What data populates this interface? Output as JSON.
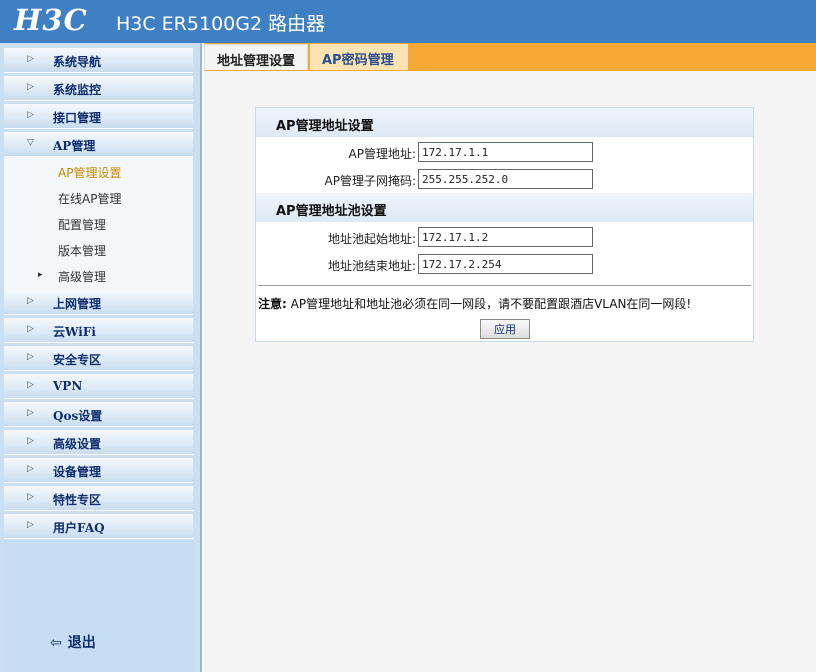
{
  "header": {
    "logo": "H3C",
    "title": "H3C ER5100G2 路由器"
  },
  "sidebar": {
    "items_top": [
      {
        "label": "系统导航"
      },
      {
        "label": "系统监控"
      },
      {
        "label": "接口管理"
      },
      {
        "label": "AP管理"
      }
    ],
    "sub_items": [
      {
        "label": "AP管理设置",
        "active": true
      },
      {
        "label": "在线AP管理"
      },
      {
        "label": "配置管理"
      },
      {
        "label": "版本管理"
      },
      {
        "label": "高级管理"
      }
    ],
    "items_bottom": [
      {
        "label": "上网管理"
      },
      {
        "label": "云WiFi"
      },
      {
        "label": "安全专区"
      },
      {
        "label": "VPN"
      },
      {
        "label": "Qos设置"
      },
      {
        "label": "高级设置"
      },
      {
        "label": "设备管理"
      },
      {
        "label": "特性专区"
      },
      {
        "label": "用户FAQ"
      }
    ],
    "logout_label": "退出"
  },
  "tabs": [
    {
      "label": "地址管理设置",
      "active": true
    },
    {
      "label": "AP密码管理",
      "active": false
    }
  ],
  "form": {
    "section1_title": "AP管理地址设置",
    "ap_addr_label": "AP管理地址:",
    "ap_addr_value": "172.17.1.1",
    "ap_mask_label": "AP管理子网掩码:",
    "ap_mask_value": "255.255.252.0",
    "section2_title": "AP管理地址池设置",
    "pool_start_label": "地址池起始地址:",
    "pool_start_value": "172.17.1.2",
    "pool_end_label": "地址池结束地址:",
    "pool_end_value": "172.17.2.254",
    "note_prefix": "注意:",
    "note_text": " AP管理地址和地址池必须在同一网段，请不要配置跟酒店VLAN在同一网段!",
    "apply_label": "应用"
  },
  "colors": {
    "header_bg": "#3f7fc3",
    "tab_bar": "#f6a935",
    "active_sub": "#c88a00",
    "nav_text": "#0e2d6e"
  },
  "icons": {
    "nav_collapsed": "▷",
    "nav_expanded": "▽",
    "sub_expander": "▸",
    "logout": "exit-icon"
  }
}
